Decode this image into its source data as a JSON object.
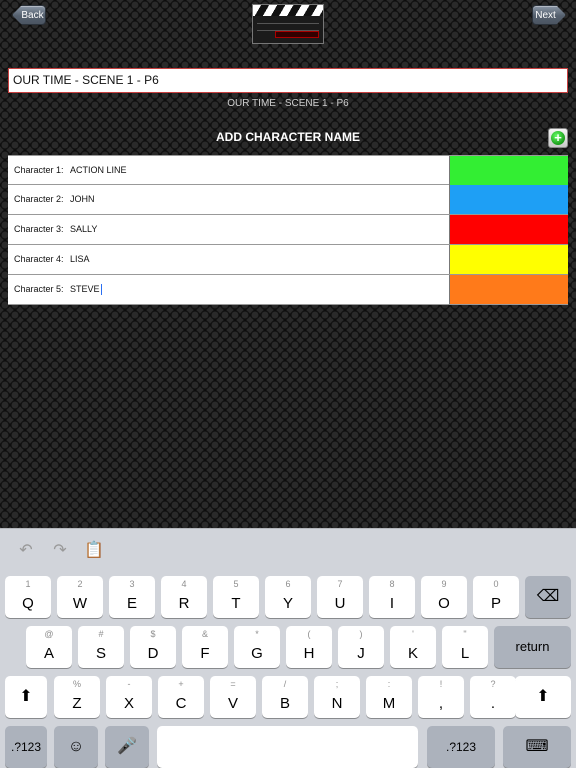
{
  "nav": {
    "back_label": "Back",
    "next_label": "Next"
  },
  "scene_title": {
    "value": "OUR TIME - SCENE 1 - P6"
  },
  "scene_subtitle": "OUR TIME - SCENE 1 - P6",
  "section_title": "ADD CHARACTER NAME",
  "characters": [
    {
      "label": "Character 1:",
      "name": "ACTION LINE",
      "color": "#33ee33"
    },
    {
      "label": "Character 2:",
      "name": "JOHN",
      "color": "#1e9ff5"
    },
    {
      "label": "Character 3:",
      "name": "SALLY",
      "color": "#ff0000"
    },
    {
      "label": "Character 4:",
      "name": "LISA",
      "color": "#ffff00"
    },
    {
      "label": "Character 5:",
      "name": "STEVE",
      "color": "#ff7a1a"
    }
  ],
  "icons": {
    "add": "plus-circle-icon",
    "undo": "undo-icon",
    "redo": "redo-icon",
    "paste": "clipboard-icon"
  },
  "keyboard": {
    "row1": [
      {
        "alt": "1",
        "key": "Q"
      },
      {
        "alt": "2",
        "key": "W"
      },
      {
        "alt": "3",
        "key": "E"
      },
      {
        "alt": "4",
        "key": "R"
      },
      {
        "alt": "5",
        "key": "T"
      },
      {
        "alt": "6",
        "key": "Y"
      },
      {
        "alt": "7",
        "key": "U"
      },
      {
        "alt": "8",
        "key": "I"
      },
      {
        "alt": "9",
        "key": "O"
      },
      {
        "alt": "0",
        "key": "P"
      }
    ],
    "row2": [
      {
        "alt": "@",
        "key": "A"
      },
      {
        "alt": "#",
        "key": "S"
      },
      {
        "alt": "$",
        "key": "D"
      },
      {
        "alt": "&",
        "key": "F"
      },
      {
        "alt": "*",
        "key": "G"
      },
      {
        "alt": "(",
        "key": "H"
      },
      {
        "alt": ")",
        "key": "J"
      },
      {
        "alt": "'",
        "key": "K"
      },
      {
        "alt": "\"",
        "key": "L"
      }
    ],
    "row3": [
      {
        "alt": "%",
        "key": "Z"
      },
      {
        "alt": "-",
        "key": "X"
      },
      {
        "alt": "+",
        "key": "C"
      },
      {
        "alt": "=",
        "key": "V"
      },
      {
        "alt": "/",
        "key": "B"
      },
      {
        "alt": ";",
        "key": "N"
      },
      {
        "alt": ":",
        "key": "M"
      },
      {
        "alt": "!",
        "key": ","
      },
      {
        "alt": "?",
        "key": "."
      }
    ],
    "return_label": "return",
    "numbers_label": ".?123",
    "numbers_label_right": ".?123"
  }
}
